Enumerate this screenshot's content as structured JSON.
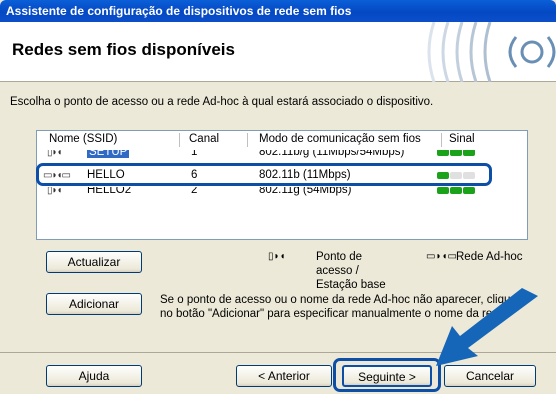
{
  "window": {
    "title": "Assistente de configuração de dispositivos de rede sem fios"
  },
  "header": {
    "title": "Redes sem fios disponíveis"
  },
  "intro": "Escolha o ponto de acesso ou a rede Ad-hoc à qual estará associado o dispositivo.",
  "table": {
    "columns": [
      "Nome (SSID)",
      "Canal",
      "Modo de comunicação sem fios",
      "Sinal"
    ],
    "rows": [
      {
        "name": "SETUP",
        "channel": "1",
        "mode": "802.11b/g (11Mbps/54Mbps)",
        "signal": 3,
        "icon": "access-point-icon"
      },
      {
        "name": "HELLO",
        "channel": "6",
        "mode": "802.11b (11Mbps)",
        "signal": 1,
        "icon": "adhoc-icon"
      },
      {
        "name": "HELLO2",
        "channel": "2",
        "mode": "802.11g (54Mbps)",
        "signal": 3,
        "icon": "access-point-icon"
      }
    ],
    "signal_colors": {
      "on": "#1aa31a",
      "off": "#e0e0e0"
    }
  },
  "buttons": {
    "refresh": "Actualizar",
    "add": "Adicionar",
    "help": "Ajuda",
    "back": "< Anterior",
    "next": "Seguinte >",
    "cancel": "Cancelar"
  },
  "legend": {
    "access_point": "Ponto de\nacesso /\nEstação base",
    "adhoc": "Rede Ad-hoc"
  },
  "note": "Se o ponto de acesso ou o nome da rede Ad-hoc não aparecer, clique no botão \"Adicionar\" para especificar manualmente o nome da rede.",
  "colors": {
    "accent": "#0d4fa6",
    "title_bar": "#0548c4"
  }
}
